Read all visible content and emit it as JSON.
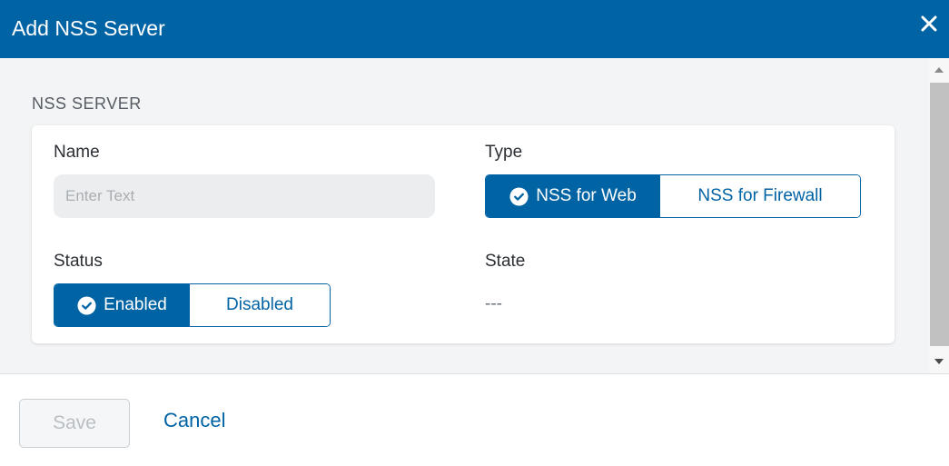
{
  "dialog": {
    "title": "Add NSS Server",
    "close_icon": "close-icon"
  },
  "section": {
    "label": "NSS SERVER"
  },
  "form": {
    "name": {
      "label": "Name",
      "value": "",
      "placeholder": "Enter Text"
    },
    "type": {
      "label": "Type",
      "options": [
        "NSS for Web",
        "NSS for Firewall"
      ],
      "selected": "NSS for Web"
    },
    "status": {
      "label": "Status",
      "options": [
        "Enabled",
        "Disabled"
      ],
      "selected": "Enabled"
    },
    "state": {
      "label": "State",
      "value": "---"
    }
  },
  "footer": {
    "save_label": "Save",
    "cancel_label": "Cancel"
  },
  "colors": {
    "header": "#0063a4",
    "accent": "#0063a4",
    "panel_bg": "#f3f4f5"
  }
}
